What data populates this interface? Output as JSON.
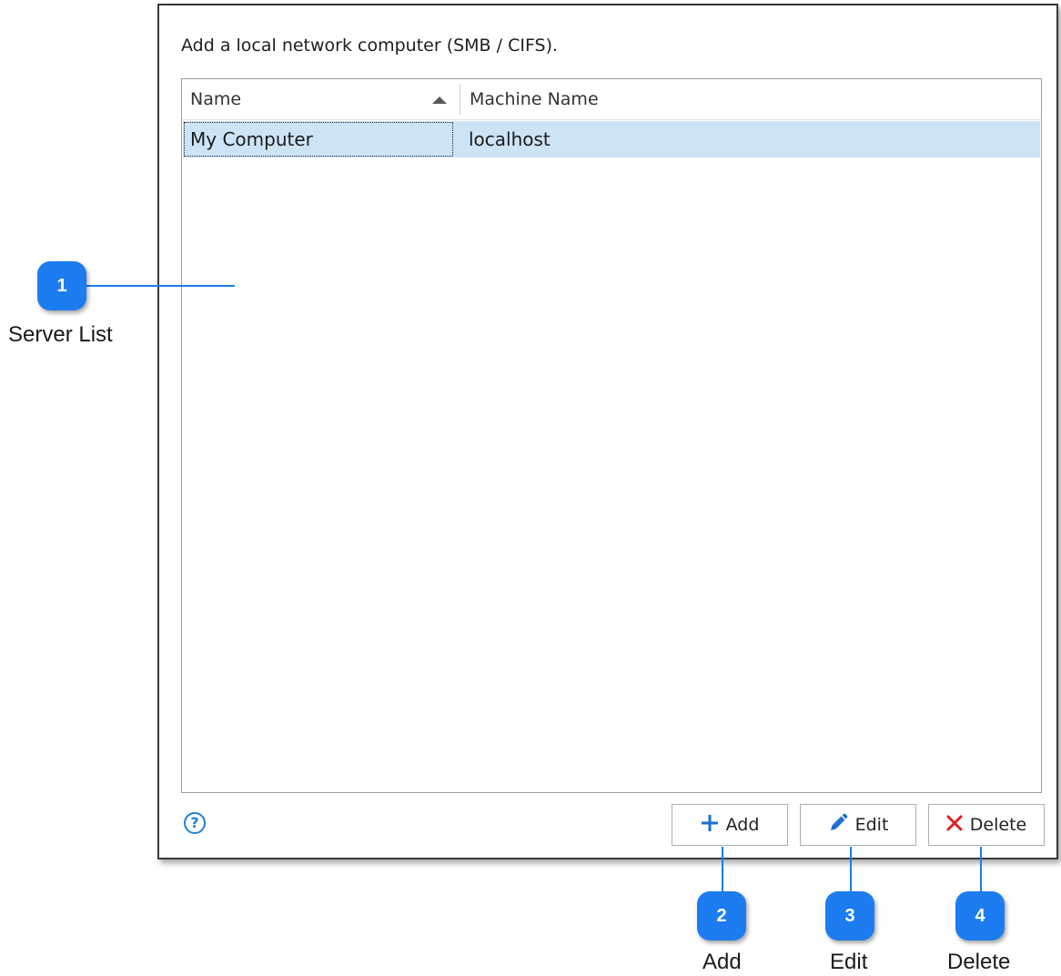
{
  "dialog": {
    "description": "Add a local network computer (SMB / CIFS).",
    "list": {
      "columns": [
        "Name",
        "Machine Name"
      ],
      "rows": [
        {
          "name": "My Computer",
          "machine": "localhost"
        }
      ]
    },
    "help_icon": "?",
    "buttons": {
      "add": "Add",
      "edit": "Edit",
      "delete": "Delete"
    }
  },
  "callouts": [
    {
      "number": "1",
      "label": "Server List"
    },
    {
      "number": "2",
      "label": "Add"
    },
    {
      "number": "3",
      "label": "Edit"
    },
    {
      "number": "4",
      "label": "Delete"
    }
  ],
  "colors": {
    "callout_blue": "#1c7cf0",
    "selection": "#cde4f7",
    "delete_red": "#e02020"
  },
  "icons": {
    "add": "plus-icon",
    "edit": "pencil-icon",
    "delete": "x-icon",
    "help": "help-icon",
    "sort": "sort-ascending-icon"
  }
}
